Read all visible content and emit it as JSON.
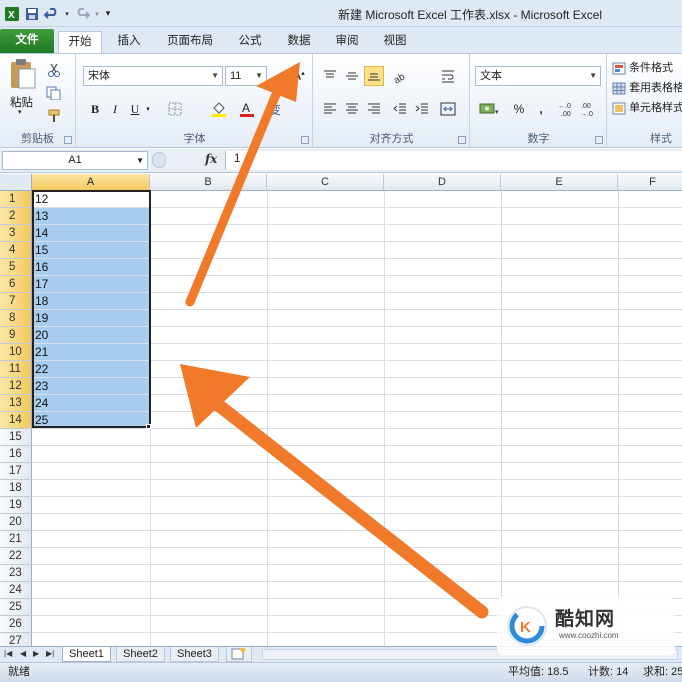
{
  "window": {
    "title": "新建 Microsoft Excel 工作表.xlsx  -  Microsoft Excel"
  },
  "quick_access": {
    "icons": [
      "excel-app-icon",
      "save-icon",
      "undo-icon",
      "redo-icon",
      "customize-icon"
    ]
  },
  "ribbon_tabs": [
    "文件",
    "开始",
    "插入",
    "页面布局",
    "公式",
    "数据",
    "审阅",
    "视图"
  ],
  "active_tab": "开始",
  "clipboard": {
    "paste_label": "粘贴",
    "group_label": "剪贴板"
  },
  "font": {
    "name": "宋体",
    "size": "11",
    "group_label": "字体",
    "bold": "B",
    "italic": "I",
    "underline": "U"
  },
  "alignment": {
    "group_label": "对齐方式"
  },
  "number": {
    "format": "文本",
    "group_label": "数字",
    "percent": "%",
    "comma": ",",
    "increase_decimal": "+.0\n.00",
    "decrease_decimal": ".00\n+.0"
  },
  "styles": {
    "group_label": "样式",
    "items": [
      "条件格式",
      "套用表格格",
      "单元格样式"
    ]
  },
  "formula_bar": {
    "name_box": "A1",
    "fx": "fx",
    "value": "1"
  },
  "columns": [
    "A",
    "B",
    "C",
    "D",
    "E",
    "F"
  ],
  "rows": [
    "1",
    "2",
    "3",
    "4",
    "5",
    "6",
    "7",
    "8",
    "9",
    "10",
    "11",
    "12",
    "13",
    "14",
    "15",
    "16",
    "17",
    "18",
    "19",
    "20",
    "21",
    "22",
    "23",
    "24",
    "25",
    "26",
    "27"
  ],
  "cells": [
    "12",
    "13",
    "14",
    "15",
    "16",
    "17",
    "18",
    "19",
    "20",
    "21",
    "22",
    "23",
    "24",
    "25"
  ],
  "sheets": [
    "Sheet1",
    "Sheet2",
    "Sheet3"
  ],
  "active_sheet": "Sheet1",
  "status": {
    "ready": "就绪",
    "average": "平均值: 18.5",
    "count": "计数: 14",
    "sum": "求和: 25"
  },
  "watermark": {
    "text": "酷知网",
    "url": "www.coozhi.com"
  },
  "colors": {
    "file_tab": "#2a8a2c",
    "selection_fill": "#a8cdee",
    "arrow": "#f07a2a",
    "header_selected": "#f4c95e"
  }
}
